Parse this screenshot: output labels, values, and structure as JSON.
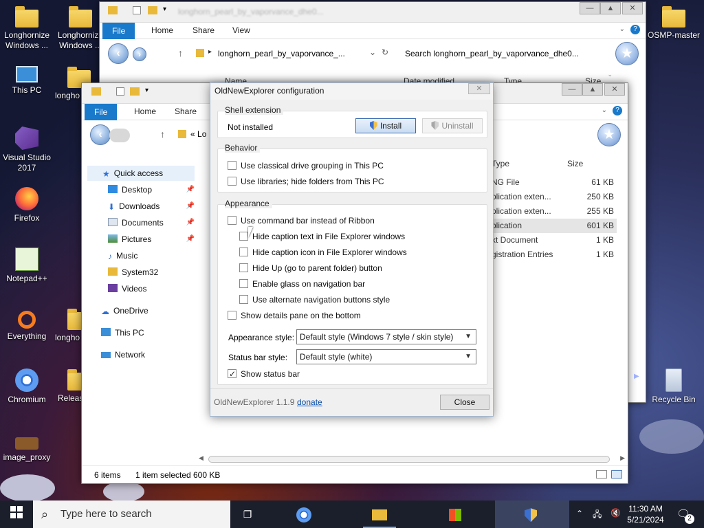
{
  "desktop": {
    "icons": [
      {
        "label": "Longhornize Windows ...",
        "icon": "folder-icon"
      },
      {
        "label": "Longhornize Windows ...",
        "icon": "folder-icon"
      },
      {
        "label": "This PC",
        "icon": "computer-icon"
      },
      {
        "label": "longho",
        "icon": "folder-icon"
      },
      {
        "label": "Visual Studio 2017",
        "icon": "visual-studio-icon"
      },
      {
        "label": "Firefox",
        "icon": "firefox-icon"
      },
      {
        "label": "Notepad++",
        "icon": "notepad-plus-plus-icon"
      },
      {
        "label": "Everything",
        "icon": "everything-search-icon"
      },
      {
        "label": "longho",
        "icon": "folder-icon"
      },
      {
        "label": "Chromium",
        "icon": "chromium-icon"
      },
      {
        "label": "Releas",
        "icon": "folder-icon"
      },
      {
        "label": "image_proxy",
        "icon": "briefcase-icon"
      },
      {
        "label": "OSMP-master",
        "icon": "folder-icon"
      },
      {
        "label": "Recycle Bin",
        "icon": "recycle-bin-icon"
      }
    ]
  },
  "back_window": {
    "title": "longhorn_pearl_by_vaporvance_dhe0...",
    "tabs": [
      "File",
      "Home",
      "Share",
      "View"
    ],
    "address": "longhorn_pearl_by_vaporvance_...",
    "search_placeholder": "Search longhorn_pearl_by_vaporvance_dhe0...",
    "columns": [
      "Name",
      "Date modified",
      "Type",
      "Size"
    ]
  },
  "front_window": {
    "tabs": [
      "File",
      "Home",
      "Share"
    ],
    "address": "Lo",
    "columns": [
      "Type",
      "Size"
    ],
    "nav_pane": [
      {
        "label": "Quick access",
        "icon": "star-icon",
        "pinned": false
      },
      {
        "label": "Desktop",
        "icon": "desktop-folder-icon",
        "pinned": true
      },
      {
        "label": "Downloads",
        "icon": "download-arrow-icon",
        "pinned": true
      },
      {
        "label": "Documents",
        "icon": "documents-icon",
        "pinned": true
      },
      {
        "label": "Pictures",
        "icon": "pictures-icon",
        "pinned": true
      },
      {
        "label": "Music",
        "icon": "music-note-icon",
        "pinned": false
      },
      {
        "label": "System32",
        "icon": "folder-icon",
        "pinned": false
      },
      {
        "label": "Videos",
        "icon": "videos-icon",
        "pinned": false
      },
      {
        "label": "OneDrive",
        "icon": "cloud-icon",
        "pinned": false
      },
      {
        "label": "This PC",
        "icon": "computer-icon",
        "pinned": false
      },
      {
        "label": "Network",
        "icon": "network-icon",
        "pinned": false
      }
    ],
    "files": [
      {
        "type": "NG File",
        "size": "61 KB"
      },
      {
        "type": "plication exten...",
        "size": "250 KB"
      },
      {
        "type": "plication exten...",
        "size": "255 KB"
      },
      {
        "type": "plication",
        "size": "601 KB"
      },
      {
        "type": "xt Document",
        "size": "1 KB"
      },
      {
        "type": "gistration Entries",
        "size": "1 KB"
      }
    ],
    "status": {
      "items": "6 items",
      "selected": "1 item selected",
      "size": "600 KB"
    }
  },
  "dialog": {
    "title": "OldNewExplorer configuration",
    "shell_extension": {
      "group_label": "Shell extension",
      "status": "Not installed",
      "install_label": "Install",
      "uninstall_label": "Uninstall"
    },
    "behavior": {
      "group_label": "Behavior",
      "options": [
        {
          "label": "Use classical drive grouping in This PC",
          "checked": false
        },
        {
          "label": "Use libraries; hide folders from This PC",
          "checked": false
        }
      ]
    },
    "appearance": {
      "group_label": "Appearance",
      "options": [
        {
          "label": "Use command bar instead of Ribbon",
          "checked": false,
          "indent": false
        },
        {
          "label": "Hide caption text in File Explorer windows",
          "checked": false,
          "indent": true
        },
        {
          "label": "Hide caption icon in File Explorer windows",
          "checked": false,
          "indent": true
        },
        {
          "label": "Hide Up (go to parent folder) button",
          "checked": false,
          "indent": true
        },
        {
          "label": "Enable glass on navigation bar",
          "checked": false,
          "indent": true
        },
        {
          "label": "Use alternate navigation buttons style",
          "checked": false,
          "indent": true
        },
        {
          "label": "Show details pane on the bottom",
          "checked": false,
          "indent": false
        }
      ],
      "appearance_style_label": "Appearance style:",
      "appearance_style_value": "Default style (Windows 7 style / skin style)",
      "status_bar_style_label": "Status bar style:",
      "status_bar_style_value": "Default style (white)",
      "show_status_bar": {
        "label": "Show status bar",
        "checked": true
      }
    },
    "footer": {
      "version": "OldNewExplorer 1.1.9",
      "donate": "donate",
      "close": "Close"
    }
  },
  "taskbar": {
    "search_placeholder": "Type here to search",
    "time": "11:30 AM",
    "date": "5/21/2024",
    "notification_count": "2"
  },
  "colors": {
    "accent": "#1979ca",
    "link": "#0b4fa8"
  }
}
